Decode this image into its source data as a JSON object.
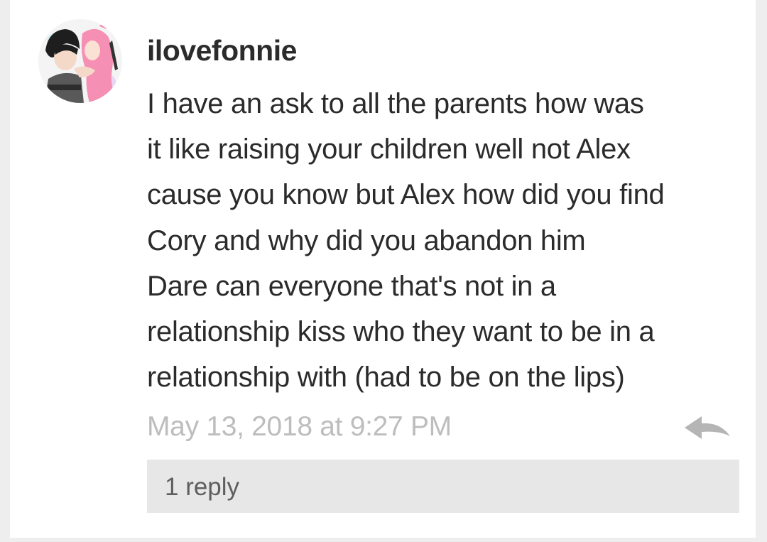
{
  "comment": {
    "username": "ilovefonnie",
    "avatar_icon": "user-avatar-illustration",
    "lines": [
      "I have an ask to all the parents how was",
      "it like raising your children well not Alex",
      "cause you know but Alex how did you find",
      "Cory and why did you abandon him",
      "Dare can everyone that's not in a",
      "relationship kiss who they want to be in a",
      "relationship with (had to be on the lips)"
    ],
    "timestamp": "May 13, 2018 at 9:27 PM",
    "reply_icon": "reply-arrow-icon",
    "replies_label": "1 reply"
  },
  "colors": {
    "text": "#2b2b2b",
    "timestamp": "#bdbdbd",
    "reply_icon": "#b5b5b5",
    "replies_bar": "#e7e7e7",
    "page_background": "#eeeeee"
  }
}
